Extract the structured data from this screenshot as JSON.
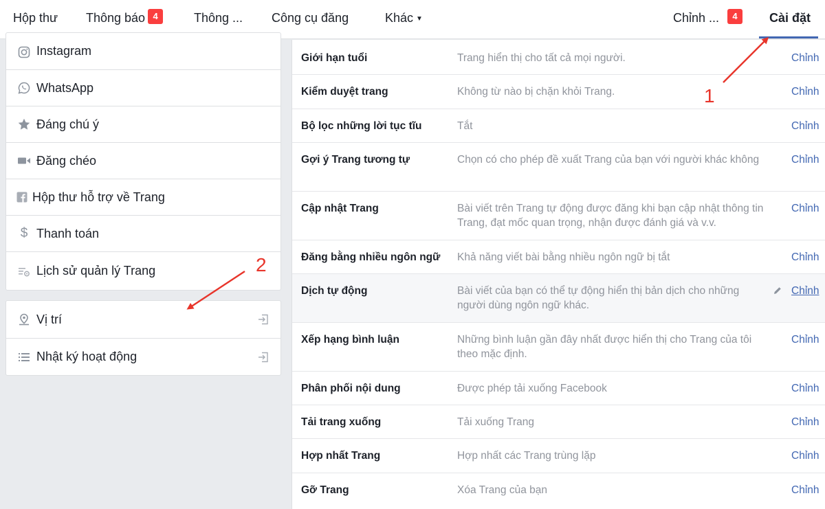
{
  "topnav": {
    "inbox": "Hộp thư",
    "notifications": "Thông báo",
    "notifications_badge": "4",
    "insights": "Thông ...",
    "publishing_tools": "Công cụ đăng",
    "more": "Khác",
    "edit_page": "Chỉnh ...",
    "edit_page_badge": "4",
    "settings": "Cài đặt"
  },
  "sidebar": {
    "items": [
      {
        "label": "Instagram",
        "icon": "instagram-icon"
      },
      {
        "label": "WhatsApp",
        "icon": "whatsapp-icon"
      },
      {
        "label": "Đáng chú ý",
        "icon": "star-icon"
      },
      {
        "label": "Đăng chéo",
        "icon": "video-camera-icon"
      },
      {
        "label": "Hộp thư hỗ trợ về Trang",
        "icon": "support-inbox-icon"
      },
      {
        "label": "Thanh toán",
        "icon": "dollar-icon"
      },
      {
        "label": "Lịch sử quản lý Trang",
        "icon": "history-settings-icon"
      }
    ],
    "secondary": [
      {
        "label": "Vị trí",
        "icon": "location-pin-icon"
      },
      {
        "label": "Nhật ký hoạt động",
        "icon": "list-icon"
      }
    ]
  },
  "settings": {
    "rows": [
      {
        "label": "Giới hạn tuổi",
        "desc": "Trang hiển thị cho tất cả mọi người.",
        "edit": "Chỉnh"
      },
      {
        "label": "Kiểm duyệt trang",
        "desc": "Không từ nào bị chặn khỏi Trang.",
        "edit": "Chỉnh"
      },
      {
        "label": "Bộ lọc những lời tục tĩu",
        "desc": "Tắt",
        "edit": "Chỉnh"
      },
      {
        "label": "Gợi ý Trang tương tự",
        "desc": "Chọn có cho phép đề xuất Trang của bạn với người khác không",
        "edit": "Chỉnh"
      },
      {
        "label": "Cập nhật Trang",
        "desc": "Bài viết trên Trang tự động được đăng khi bạn cập nhật thông tin Trang, đạt mốc quan trọng, nhận được đánh giá và v.v.",
        "edit": "Chỉnh"
      },
      {
        "label": "Đăng bằng nhiều ngôn ngữ",
        "desc": "Khả năng viết bài bằng nhiều ngôn ngữ bị tắt",
        "edit": "Chỉnh"
      },
      {
        "label": "Dịch tự động",
        "desc": "Bài viết của bạn có thể tự động hiển thị bản dịch cho những người dùng ngôn ngữ khác.",
        "edit": "Chỉnh"
      },
      {
        "label": "Xếp hạng bình luận",
        "desc": "Những bình luận gần đây nhất được hiển thị cho Trang của tôi theo mặc định.",
        "edit": "Chỉnh"
      },
      {
        "label": "Phân phối nội dung",
        "desc": "Được phép tải xuống Facebook",
        "edit": "Chỉnh"
      },
      {
        "label": "Tải trang xuống",
        "desc": "Tải xuống Trang",
        "edit": "Chỉnh"
      },
      {
        "label": "Hợp nhất Trang",
        "desc": "Hợp nhất các Trang trùng lặp",
        "edit": "Chỉnh"
      },
      {
        "label": "Gỡ Trang",
        "desc": "Xóa Trang của bạn",
        "edit": "Chỉnh"
      }
    ]
  },
  "annotations": {
    "step1": "1",
    "step2": "2"
  },
  "colors": {
    "accent": "#4267b2",
    "badge": "#fa3e3e",
    "annotation": "#e8352b"
  }
}
